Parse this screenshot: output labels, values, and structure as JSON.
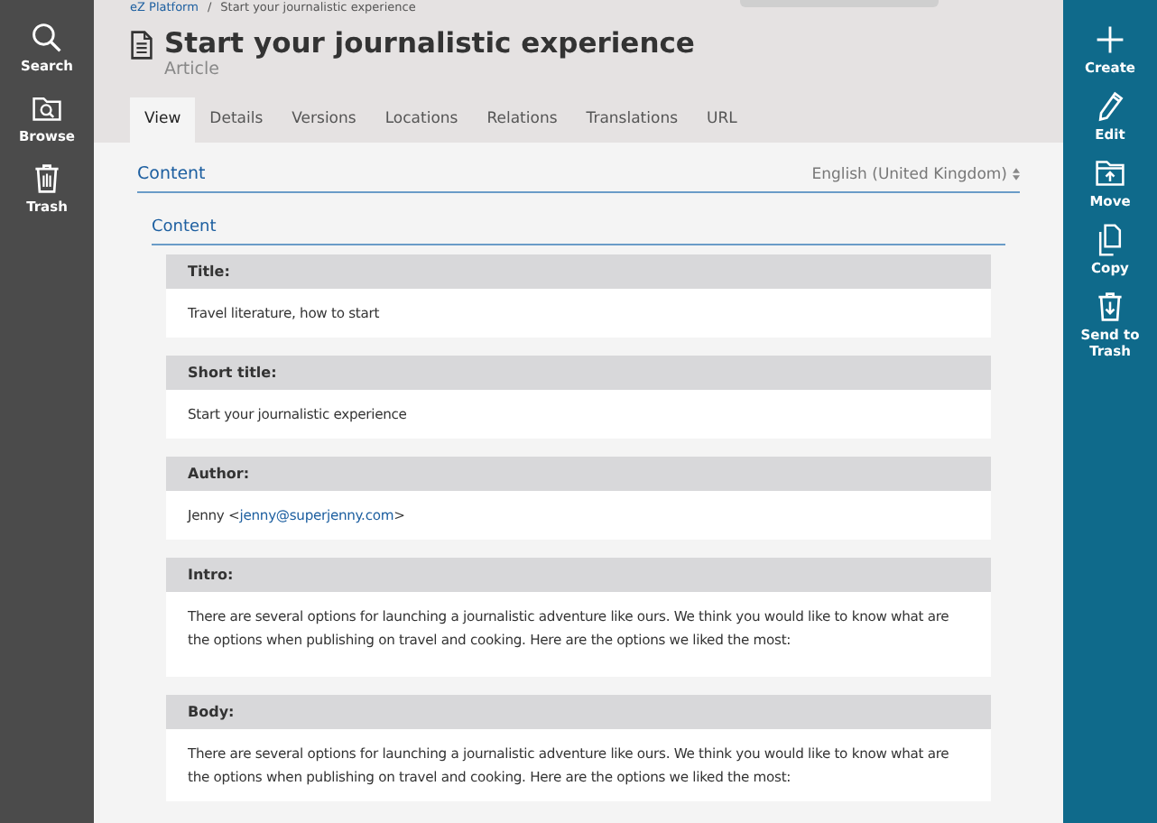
{
  "left_nav": [
    {
      "kind": "search",
      "label": "Search"
    },
    {
      "kind": "browse",
      "label": "Browse"
    },
    {
      "kind": "trash",
      "label": "Trash"
    }
  ],
  "breadcrumb": {
    "root": "eZ Platform",
    "separator": "/",
    "current": "Start your journalistic experience"
  },
  "header": {
    "title": "Start your journalistic experience",
    "content_type": "Article"
  },
  "tabs": [
    {
      "label": "View",
      "selected": true
    },
    {
      "label": "Details",
      "selected": false
    },
    {
      "label": "Versions",
      "selected": false
    },
    {
      "label": "Locations",
      "selected": false
    },
    {
      "label": "Relations",
      "selected": false
    },
    {
      "label": "Translations",
      "selected": false
    },
    {
      "label": "URL",
      "selected": false
    }
  ],
  "content": {
    "heading": "Content",
    "language": "English (United Kingdom)",
    "group_heading": "Content",
    "fields": [
      {
        "label": "Title:",
        "value": "Travel literature, how to start"
      },
      {
        "label": "Short title:",
        "value": "Start your journalistic experience"
      },
      {
        "label": "Author:",
        "value": "Jenny <",
        "link": "jenny@superjenny.com",
        "value_after": ">"
      },
      {
        "label": "Intro:",
        "value": "There are several options for launching a journalistic adventure like ours. We think you would like to know what are the options when publishing on travel and cooking. Here are the options we liked the most:"
      },
      {
        "label": "Body:",
        "value": "There are several options for launching a journalistic adventure like ours. We think you would like to know what are the options when publishing on travel and cooking. Here are the options we liked the most:"
      }
    ]
  },
  "right_nav": [
    {
      "kind": "create",
      "label": "Create"
    },
    {
      "kind": "edit",
      "label": "Edit"
    },
    {
      "kind": "move",
      "label": "Move"
    },
    {
      "kind": "copy",
      "label": "Copy"
    },
    {
      "kind": "send_to_trash",
      "label": "Send to Trash"
    }
  ]
}
